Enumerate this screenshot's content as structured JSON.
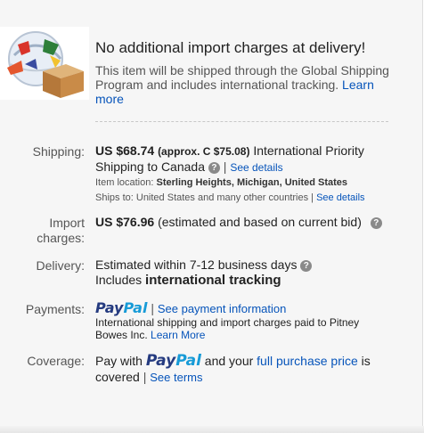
{
  "gsp": {
    "headline": "No additional import charges at delivery!",
    "description": "This item will be shipped through the Global Shipping Program and includes international tracking.",
    "learn_more": "Learn more",
    "logo_icon": "globe-box-icon"
  },
  "shipping": {
    "label": "Shipping:",
    "amount": "US $68.74",
    "approx": "(approx. C $75.08)",
    "service": "International Priority Shipping to Canada",
    "see_details": "See details",
    "location_label": "Item location:",
    "location_value": "Sterling Heights, Michigan, United States",
    "ships_to_label": "Ships to:",
    "ships_to_value": "United States and many other countries",
    "ships_to_details": "See details"
  },
  "import": {
    "label_line1": "Import",
    "label_line2": "charges:",
    "amount": "US $76.96",
    "note": "(estimated and based on current bid)"
  },
  "delivery": {
    "label": "Delivery:",
    "estimate": "Estimated within 7-12 business days",
    "includes": "Includes",
    "tracking": "international tracking"
  },
  "payments": {
    "label": "Payments:",
    "paypal_part1": "Pay",
    "paypal_part2": "Pal",
    "see_payment": "See payment information",
    "note": "International shipping and import charges paid to Pitney Bowes Inc.",
    "learn_more": "Learn More"
  },
  "coverage": {
    "label": "Coverage:",
    "pay_with": "Pay with",
    "paypal_part1": "Pay",
    "paypal_part2": "Pal",
    "and_your": "and your",
    "full_price": "full purchase price",
    "is": "is",
    "covered": "covered",
    "see_terms": "See terms"
  },
  "colors": {
    "link": "#0654ba",
    "paypal_dark": "#253b80",
    "paypal_light": "#179bd7"
  }
}
